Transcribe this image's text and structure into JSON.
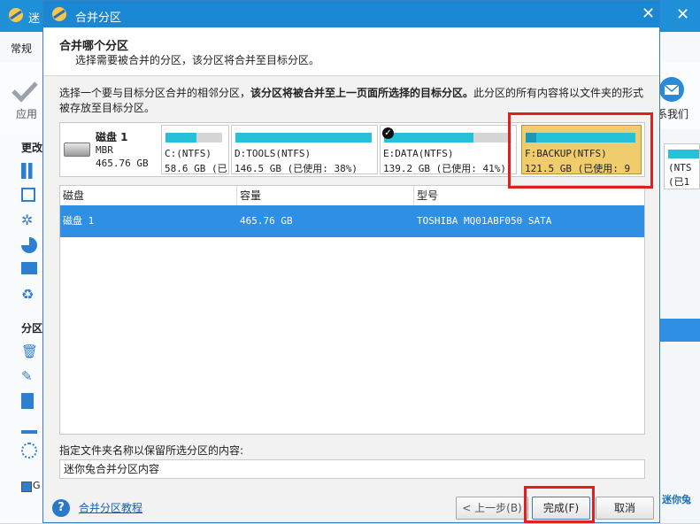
{
  "background": {
    "title": "迷",
    "menu_label": "常规",
    "apply_label": "应用",
    "contact_label": "系我们",
    "side_section1": "更改",
    "side_section2": "分区",
    "right_text1": "(NTS",
    "right_text2": "(已1",
    "right_brand": "迷你兔",
    "legend_char": "G"
  },
  "dialog": {
    "title": "合并分区",
    "header_title": "合并哪个分区",
    "header_subtitle": "选择需要被合并的分区，该分区将合并至目标分区。",
    "instruction_part1": "选择一个要与目标分区合并的相邻分区，",
    "instruction_bold": "该分区将被合并至上一页面所选择的目标分区。",
    "instruction_part2": "此分区的所有内容将以文件夹的形式被存放至目标分区。",
    "disk": {
      "name": "磁盘 1",
      "type": "MBR",
      "size": "465.76 GB"
    },
    "partitions": [
      {
        "label": "C:(NTFS)",
        "info": "58.6 GB (已",
        "used_fraction": 0.55,
        "selected": false,
        "checked": false
      },
      {
        "label": "D:TOOLS(NTFS)",
        "info": "146.5 GB (已使用: 38%)",
        "used_fraction": 1.0,
        "selected": false,
        "checked": false
      },
      {
        "label": "E:DATA(NTFS)",
        "info": "139.2 GB (已使用: 41%)",
        "used_fraction": 0.7,
        "selected": false,
        "checked": true
      },
      {
        "label": "F:BACKUP(NTFS)",
        "info": "121.5 GB (已使用: 9",
        "used_fraction": 0.1,
        "selected": true,
        "checked": false
      }
    ],
    "table": {
      "headers": [
        "磁盘",
        "容量",
        "型号"
      ],
      "rows": [
        [
          "磁盘 1",
          "465.76 GB",
          "TOSHIBA MQ01ABF050 SATA"
        ]
      ]
    },
    "folder_label": "指定文件夹名称以保留所选分区的内容:",
    "folder_value": "迷你兔合并分区内容",
    "help_link": "合并分区教程",
    "buttons": {
      "back": "< 上一步(B)",
      "finish": "完成(F)",
      "cancel": "取消"
    }
  },
  "colors": {
    "accent": "#1a87d4",
    "selection": "#2e8fe3",
    "selected_partition": "#f0cc6c",
    "usage_fill": "#26c0d8",
    "highlight": "#e02020"
  }
}
